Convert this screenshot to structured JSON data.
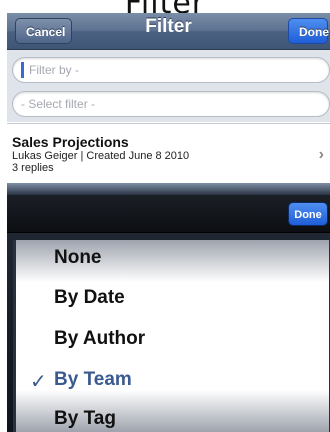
{
  "page_heading": "Filter",
  "navbar": {
    "title": "Filter",
    "cancel_label": "Cancel",
    "done_label": "Done"
  },
  "form": {
    "filter_placeholder": "Filter by -",
    "select_placeholder": "- Select filter -"
  },
  "list": {
    "items": [
      {
        "title": "Sales Projections",
        "meta": "Lukas Geiger | Created June 8 2010",
        "replies": "3 replies"
      }
    ]
  },
  "picker": {
    "done_label": "Done",
    "options": [
      {
        "label": "None",
        "selected": false
      },
      {
        "label": "By Date",
        "selected": false
      },
      {
        "label": "By Author",
        "selected": false
      },
      {
        "label": "By Team",
        "selected": true
      },
      {
        "label": "By Tag",
        "selected": false
      }
    ],
    "check_glyph": "✓"
  },
  "colors": {
    "navbar": "#4c6283",
    "done_button": "#1f5ed8",
    "selected_text": "#3b5a8f"
  },
  "icons": {
    "row_chevron": "chevron-right-icon",
    "selected_marker": "checkmark-icon"
  }
}
